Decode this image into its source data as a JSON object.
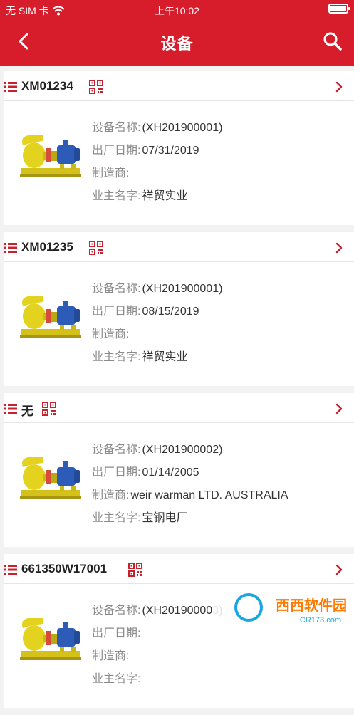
{
  "status_bar": {
    "carrier": "无 SIM 卡",
    "time": "上午10:02"
  },
  "nav": {
    "title": "设备"
  },
  "labels": {
    "name": "设备名称:",
    "date": "出厂日期:",
    "maker": "制造商:",
    "owner": "业主名字:"
  },
  "devices": [
    {
      "code": "XM01234",
      "name": "(XH201900001)",
      "date": "07/31/2019",
      "maker": "",
      "owner": "祥贸实业"
    },
    {
      "code": "XM01235",
      "name": "(XH201900001)",
      "date": "08/15/2019",
      "maker": "",
      "owner": "祥贸实业"
    },
    {
      "code": "无",
      "name": "(XH201900002)",
      "date": "01/14/2005",
      "maker": "weir warman LTD. AUSTRALIA",
      "owner": "宝钢电厂"
    },
    {
      "code": "661350W17001",
      "name": "(XH201900003)",
      "date": "",
      "maker": "",
      "owner": ""
    }
  ],
  "icons": {
    "back": "chevron-left-icon",
    "search": "search-icon",
    "list": "list-icon",
    "qr": "qr-code-icon",
    "chevron": "chevron-right-icon"
  },
  "colors": {
    "header": "#d71c2c",
    "accent": "#c8202d"
  },
  "watermark": {
    "text": "西西软件园",
    "sub": "CR173.com"
  }
}
